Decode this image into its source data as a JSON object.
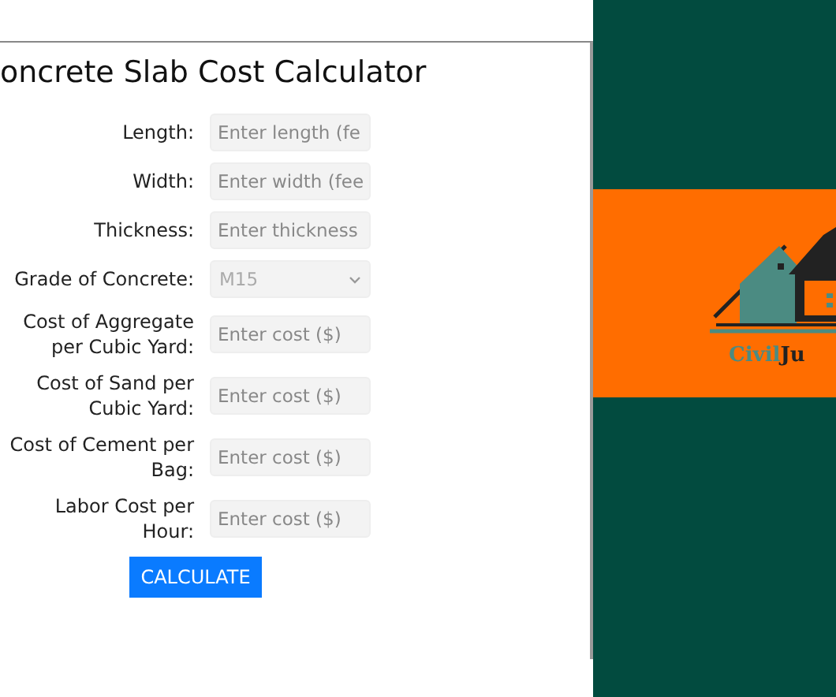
{
  "title": "oncrete Slab Cost Calculator",
  "fields": [
    {
      "kind": "input",
      "label": "Length:",
      "placeholder": "Enter length (fe"
    },
    {
      "kind": "input",
      "label": "Width:",
      "placeholder": "Enter width (fee"
    },
    {
      "kind": "input",
      "label": "Thickness:",
      "placeholder": "Enter thickness"
    },
    {
      "kind": "select",
      "label": "Grade of Concrete:",
      "value": "M15"
    },
    {
      "kind": "input",
      "label": "Cost of Aggregate per Cubic Yard:",
      "placeholder": "Enter cost ($)"
    },
    {
      "kind": "input",
      "label": "Cost of Sand per Cubic Yard:",
      "placeholder": "Enter cost ($)"
    },
    {
      "kind": "input",
      "label": "Cost of Cement per Bag:",
      "placeholder": "Enter cost ($)"
    },
    {
      "kind": "input",
      "label": "Labor Cost per Hour:",
      "placeholder": "Enter cost ($)"
    }
  ],
  "button": "CALCULATE",
  "logo": {
    "parts": [
      {
        "text": "Civil",
        "color": "#4b8b82"
      },
      {
        "text": "Ju",
        "color": "#222222"
      }
    ]
  }
}
